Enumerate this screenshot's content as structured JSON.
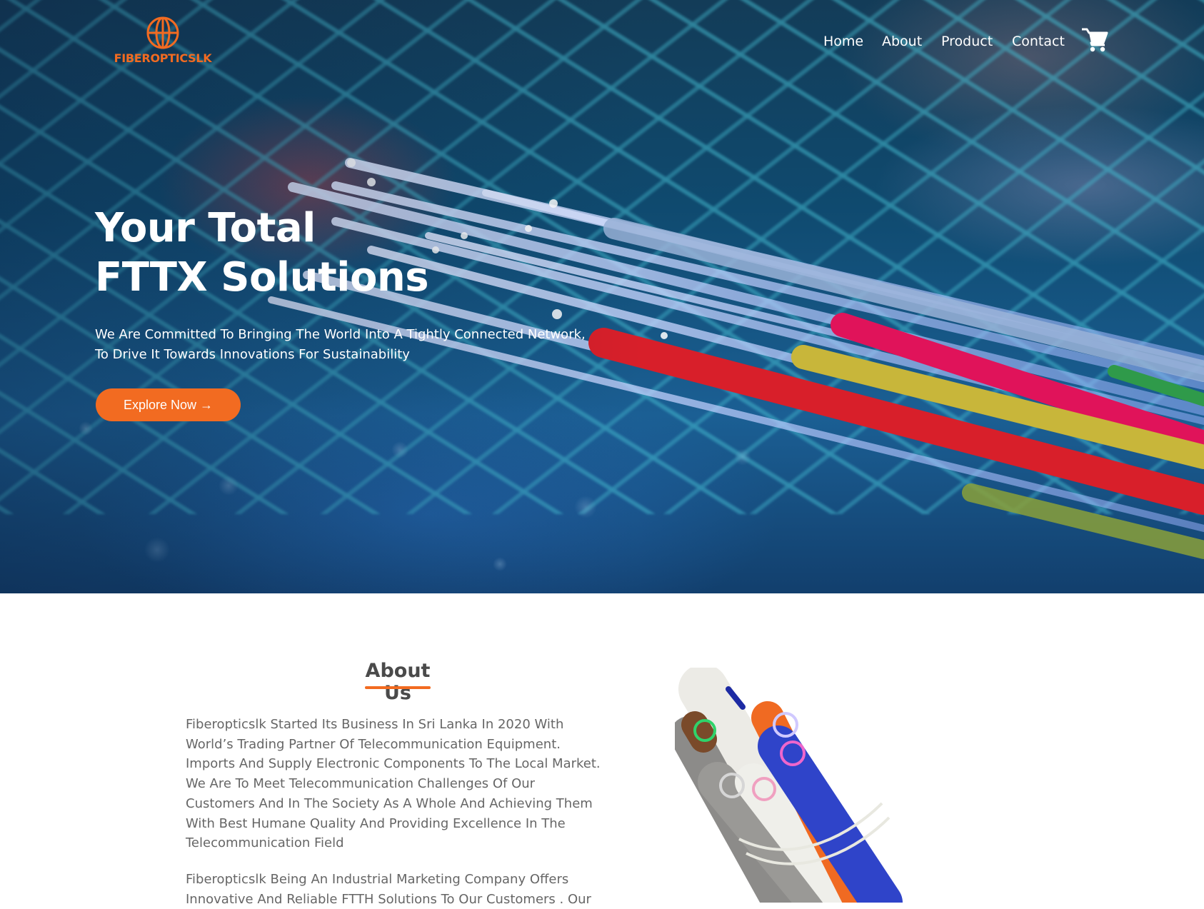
{
  "brand": {
    "name": "FIBEROPTICSLK",
    "color": "#f26b21"
  },
  "nav": {
    "items": [
      {
        "label": "Home"
      },
      {
        "label": "About"
      },
      {
        "label": "Product"
      },
      {
        "label": "Contact"
      }
    ],
    "cart_icon": "shopping-cart-icon"
  },
  "hero": {
    "title_line1": "Your Total",
    "title_line2": "FTTX Solutions",
    "subtitle_line1": "We Are Committed To Bringing The World Into A Tightly Connected Network,",
    "subtitle_line2": "To Drive It Towards Innovations For Sustainability",
    "cta_label": "Explore Now →"
  },
  "about": {
    "title": "About Us",
    "paragraph1_lines": [
      "Fiberopticslk Started Its Business In Sri Lanka In 2020 With",
      "World’s Trading Partner Of Telecommunication Equipment.",
      "Imports And Supply Electronic Components To The Local Market.",
      "We Are To Meet Telecommunication Challenges Of Our",
      "Customers And In The Society As A Whole And Achieving Them",
      "With Best Humane Quality And Providing Excellence In The",
      "Telecommunication Field"
    ],
    "paragraph2_lines": [
      "Fiberopticslk Being An Industrial Marketing Company Offers",
      "Innovative And Reliable FTTH Solutions To Our Customers . Our"
    ]
  }
}
